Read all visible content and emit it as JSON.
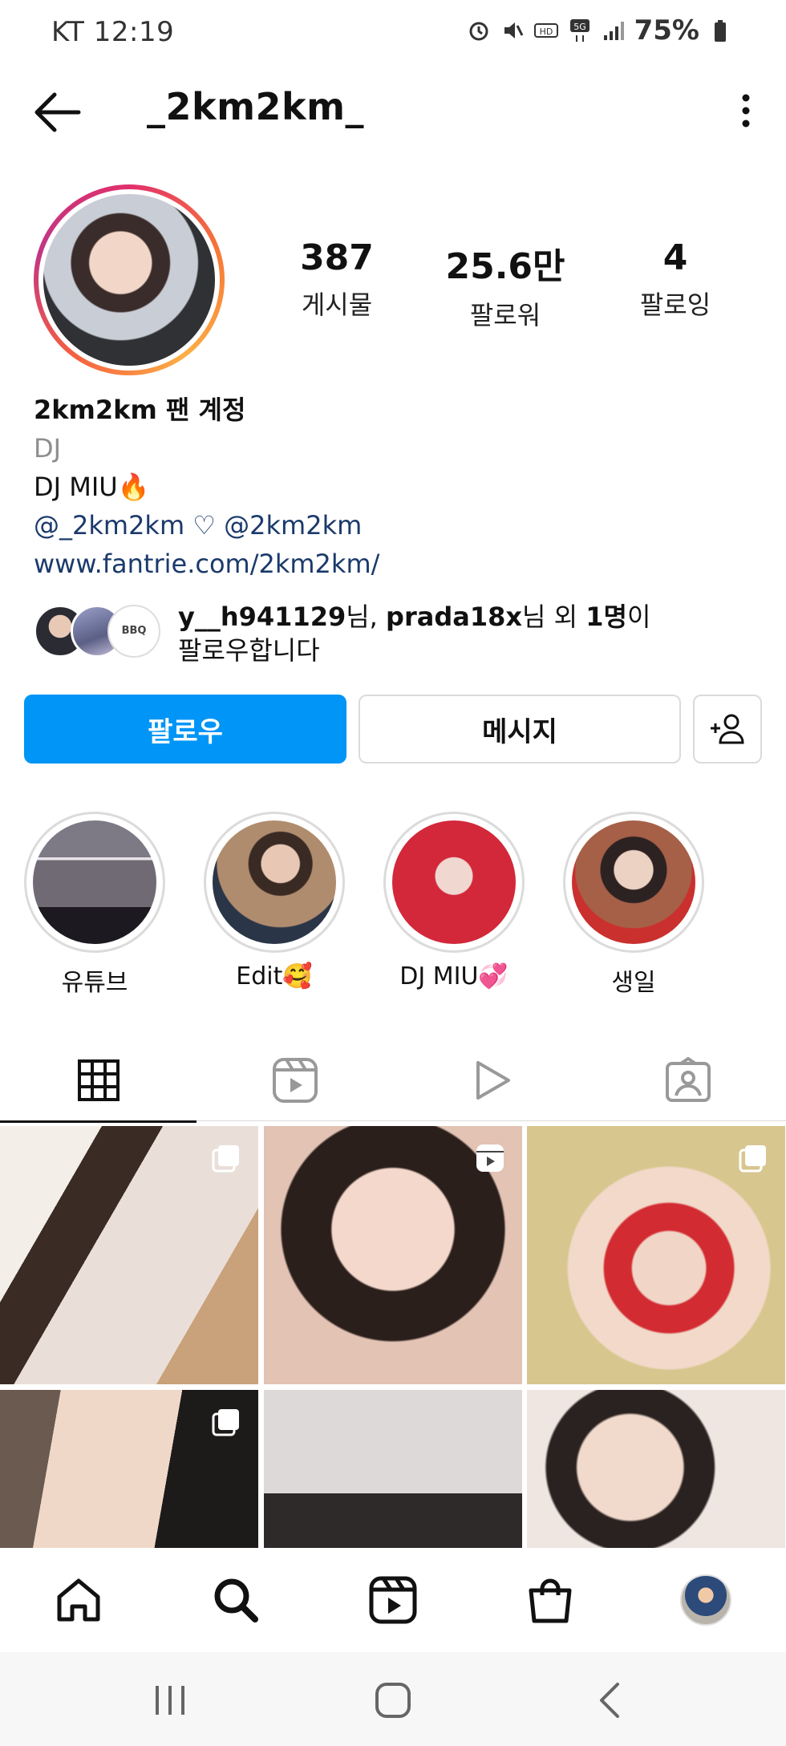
{
  "status_bar": {
    "carrier_time": "KT 12:19",
    "battery": "75%"
  },
  "header": {
    "username": "_2km2km_"
  },
  "profile": {
    "stats": [
      {
        "value": "387",
        "label": "게시물"
      },
      {
        "value": "25.6만",
        "label": "팔로워"
      },
      {
        "value": "4",
        "label": "팔로잉"
      }
    ],
    "name": "2km2km 팬 계정",
    "category": "DJ",
    "bio_line": "DJ MIU🔥",
    "mentions": "@_2km2km ♡ @2km2km",
    "website": "www.fantrie.com/2km2km/",
    "followed_by": {
      "user1": "y__h941129",
      "suffix1": "님, ",
      "user2": "prada18x",
      "suffix2": "님 외 ",
      "count": "1명",
      "suffix3": "이",
      "line2": "팔로우합니다",
      "third_avatar_text": "BBQ"
    }
  },
  "actions": {
    "follow": "팔로우",
    "message": "메시지"
  },
  "highlights": [
    {
      "label": "유튜브"
    },
    {
      "label": "Edit🥰"
    },
    {
      "label": "DJ MIU💞"
    },
    {
      "label": "생일"
    }
  ],
  "tabs": [
    "grid-icon",
    "reels-icon",
    "video-icon",
    "tagged-icon"
  ],
  "colors": {
    "primary_blue": "#0095f6",
    "link_blue": "#1b3a6b",
    "muted_gray": "#8e8e8e"
  }
}
